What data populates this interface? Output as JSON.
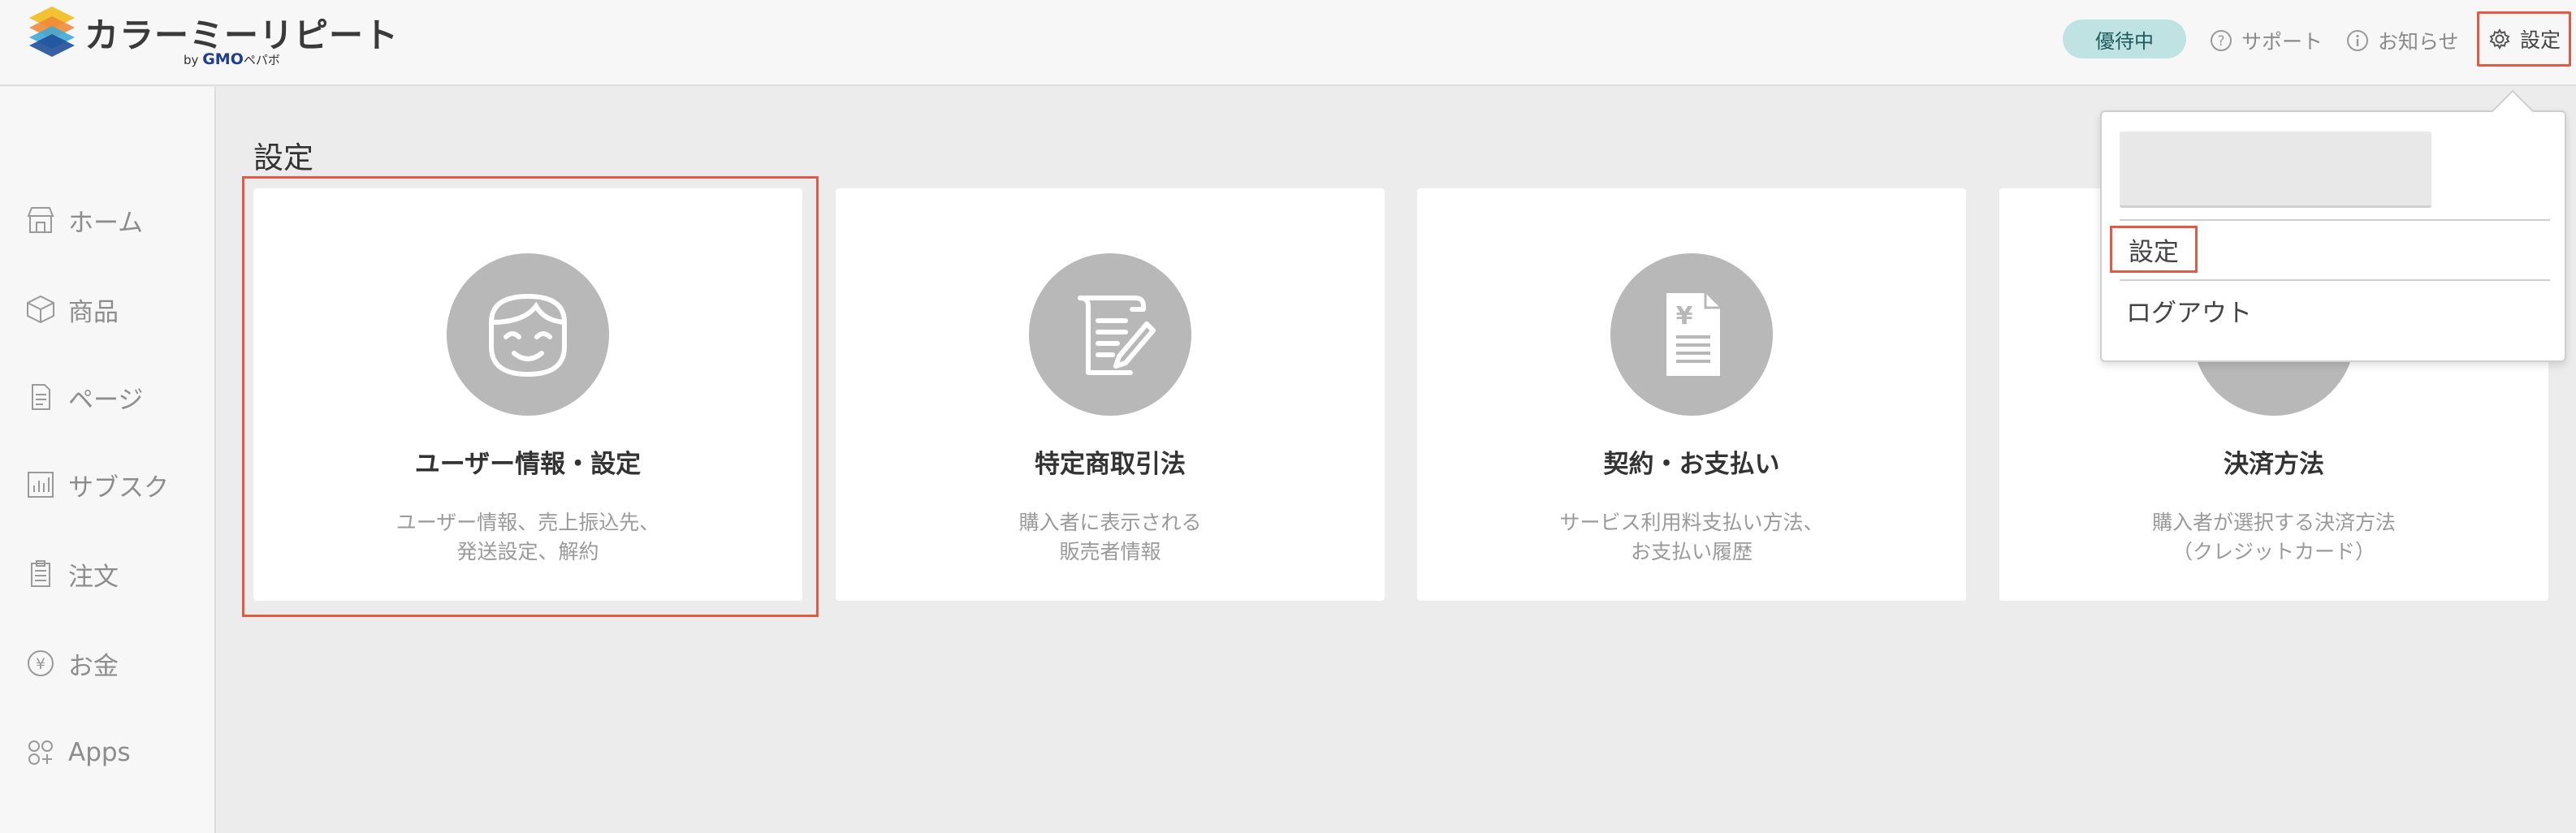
{
  "app": {
    "logo_text": "カラーミーリピート",
    "logo_by": "by",
    "logo_gmo": "GMO",
    "logo_company": "ペパボ"
  },
  "header": {
    "badge": "優待中",
    "support": "サポート",
    "news": "お知らせ",
    "settings": "設定"
  },
  "sidebar": {
    "items": [
      {
        "label": "ホーム",
        "icon": "store-icon"
      },
      {
        "label": "商品",
        "icon": "box-icon"
      },
      {
        "label": "ページ",
        "icon": "document-icon"
      },
      {
        "label": "サブスク",
        "icon": "bar-chart-icon"
      },
      {
        "label": "注文",
        "icon": "clipboard-icon"
      },
      {
        "label": "お金",
        "icon": "yen-icon"
      },
      {
        "label": "Apps",
        "icon": "apps-icon"
      }
    ]
  },
  "main": {
    "title": "設定",
    "cards": [
      {
        "title": "ユーザー情報・設定",
        "desc1": "ユーザー情報、売上振込先、",
        "desc2": "発送設定、解約",
        "icon": "face-icon"
      },
      {
        "title": "特定商取引法",
        "desc1": "購入者に表示される",
        "desc2": "販売者情報",
        "icon": "document-pen-icon"
      },
      {
        "title": "契約・お支払い",
        "desc1": "サービス利用料支払い方法、",
        "desc2": "お支払い履歴",
        "icon": "yen-document-icon"
      },
      {
        "title": "決済方法",
        "desc1": "購入者が選択する決済方法",
        "desc2": "（クレジットカード）",
        "icon": "credit-card-icon"
      }
    ]
  },
  "dropdown": {
    "settings": "設定",
    "logout": "ログアウト"
  },
  "colors": {
    "highlight": "#e05a46",
    "badge_bg": "#bfe3e3",
    "icon_circle": "#b8b8b8"
  }
}
